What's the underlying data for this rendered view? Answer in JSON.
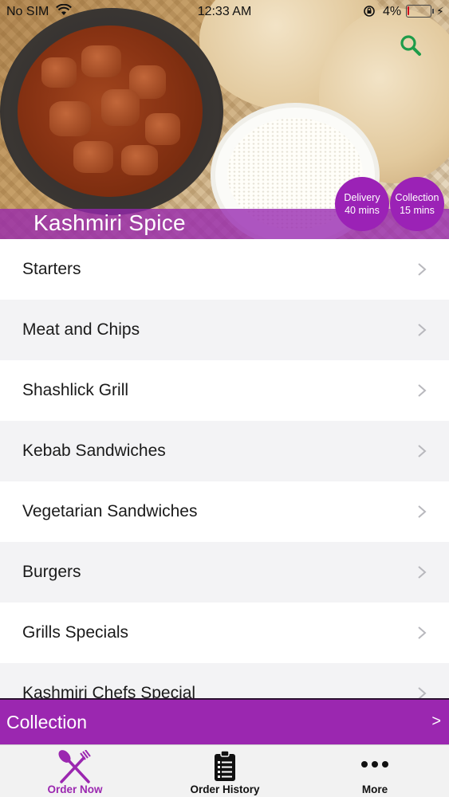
{
  "status_bar": {
    "carrier": "No SIM",
    "time": "12:33 AM",
    "battery_percent": "4%",
    "battery_level": 0.04
  },
  "hero": {
    "restaurant_name": "Kashmiri Spice",
    "delivery": {
      "label": "Delivery",
      "time": "40 mins"
    },
    "collection": {
      "label": "Collection",
      "time": "15 mins"
    },
    "search_icon": "search-icon"
  },
  "menu": {
    "items": [
      {
        "label": "Starters"
      },
      {
        "label": "Meat and Chips"
      },
      {
        "label": "Shashlick Grill"
      },
      {
        "label": "Kebab Sandwiches"
      },
      {
        "label": "Vegetarian Sandwiches"
      },
      {
        "label": "Burgers"
      },
      {
        "label": "Grills Specials"
      },
      {
        "label": "Kashmiri Chefs Special"
      }
    ]
  },
  "collection_bar": {
    "label": "Collection",
    "arrow": ">"
  },
  "tabs": [
    {
      "label": "Order Now",
      "icon": "fork-knife-icon",
      "active": true
    },
    {
      "label": "Order History",
      "icon": "clipboard-list-icon",
      "active": false
    },
    {
      "label": "More",
      "icon": "more-dots-icon",
      "active": false
    }
  ],
  "colors": {
    "accent": "#9b27b0",
    "search_green": "#1e9c4a",
    "chevron": "#b8b8bd",
    "battery_low": "#d0021b"
  }
}
